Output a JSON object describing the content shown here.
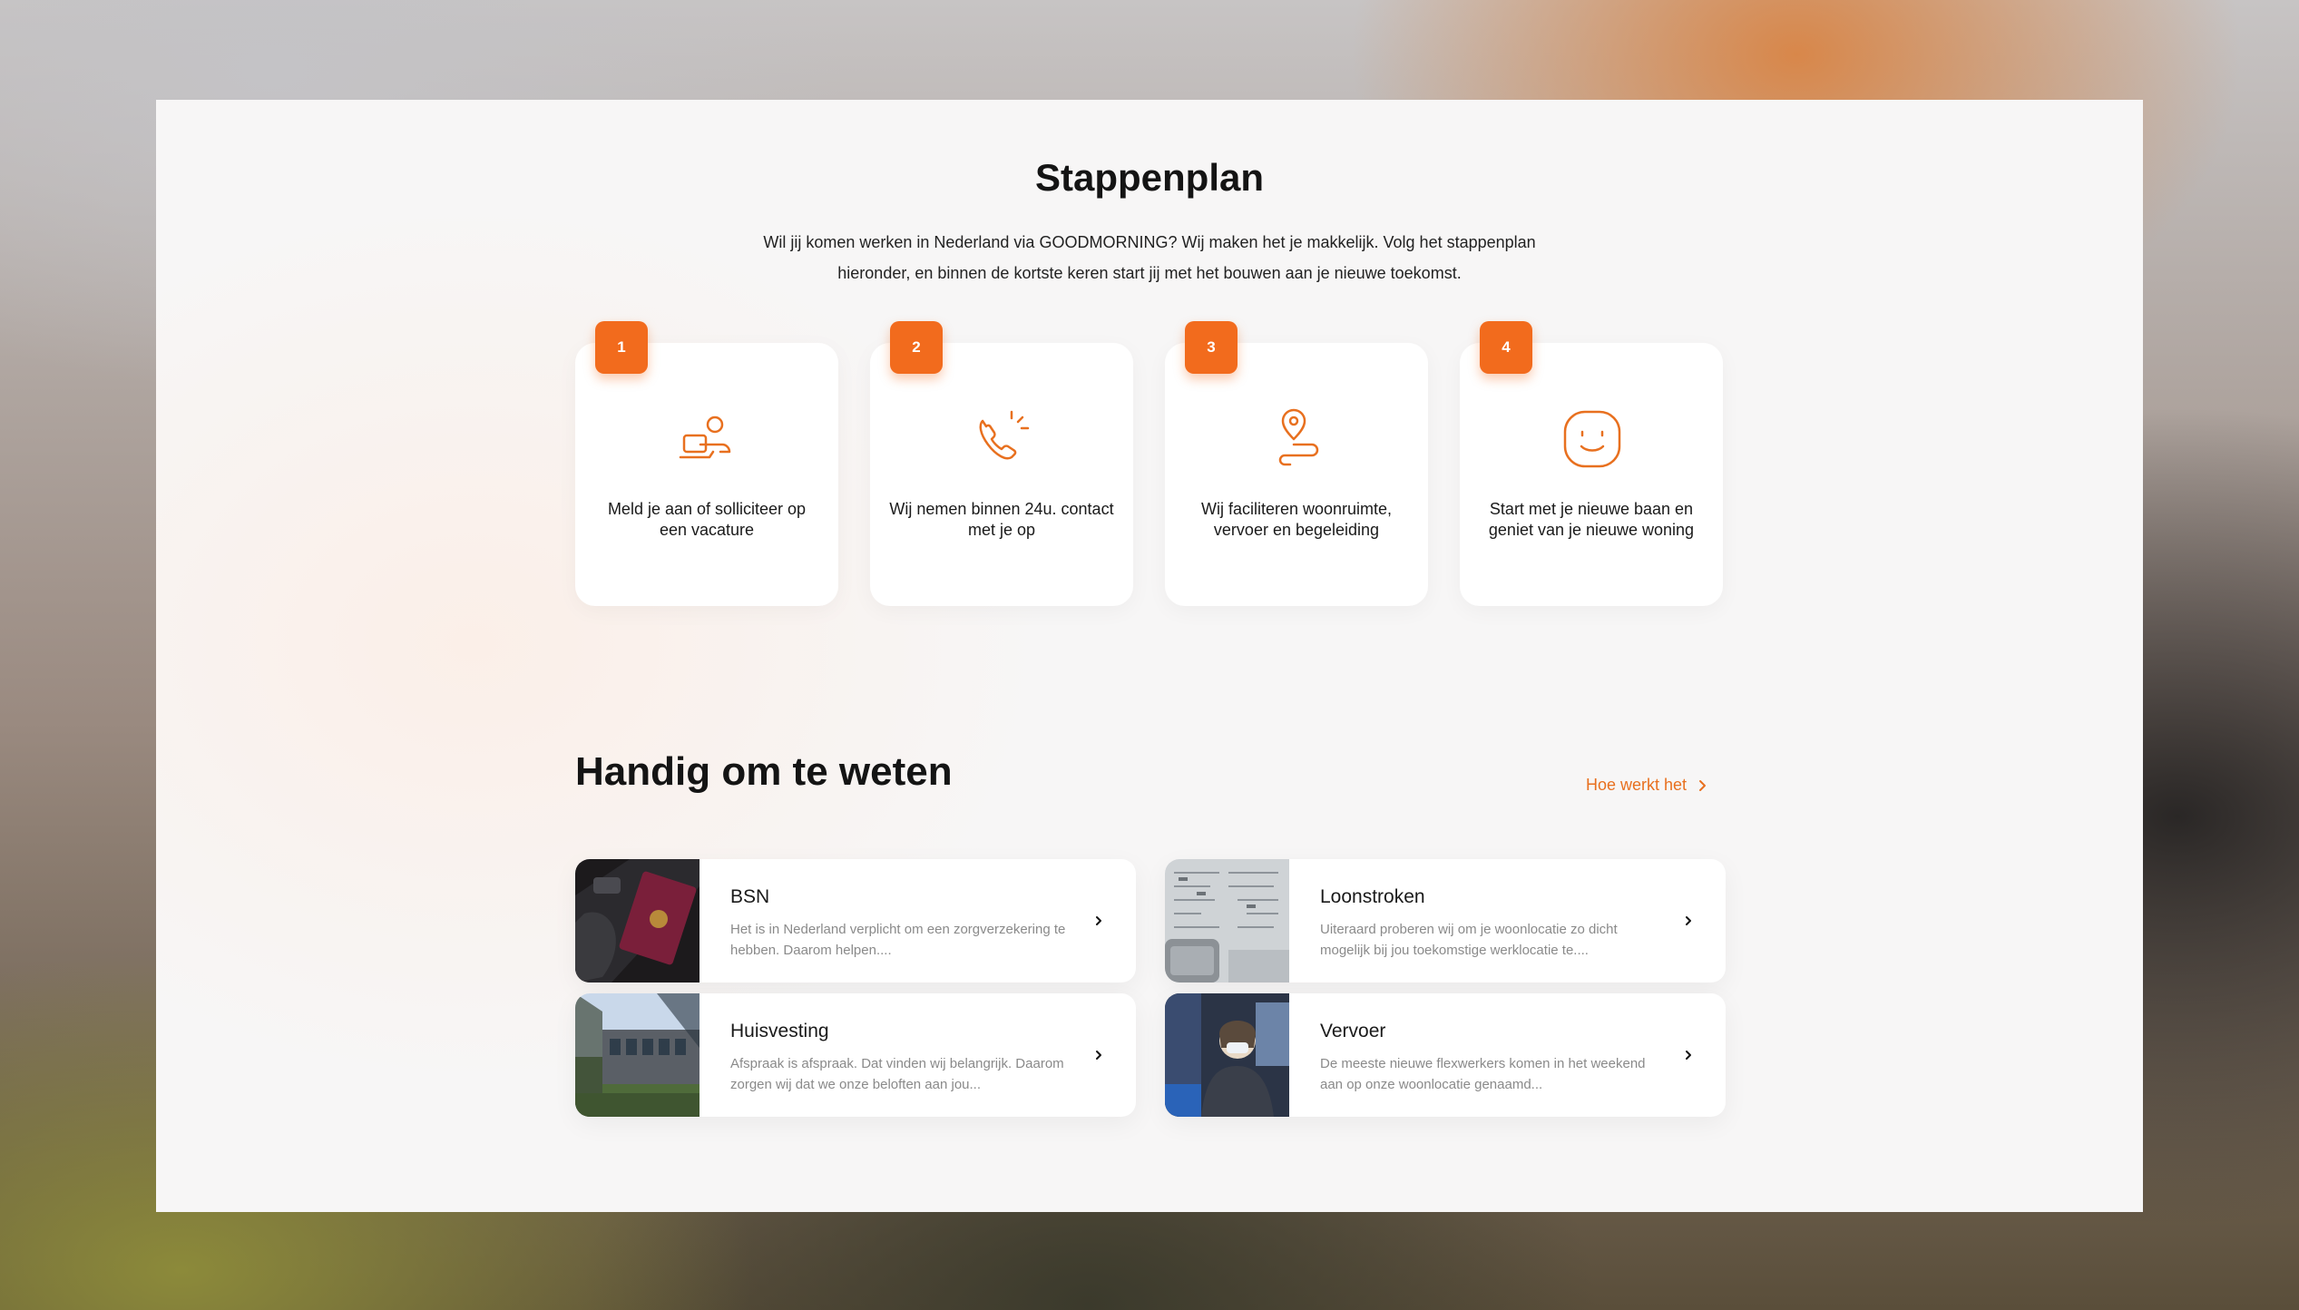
{
  "stappenplan": {
    "title": "Stappenplan",
    "intro": "Wil jij komen werken in Nederland via GOODMORNING? Wij maken het je makkelijk. Volg het stappenplan hieronder, en binnen de kortste keren start jij met het bouwen aan je nieuwe toekomst.",
    "steps": [
      {
        "number": "1",
        "icon": "person-laptop-icon",
        "label": "Meld je aan of solliciteer op een vacature"
      },
      {
        "number": "2",
        "icon": "phone-call-icon",
        "label": "Wij nemen binnen 24u. contact met je op"
      },
      {
        "number": "3",
        "icon": "location-route-icon",
        "label": "Wij faciliteren woonruimte, vervoer en begeleiding"
      },
      {
        "number": "4",
        "icon": "smiley-icon",
        "label": "Start met je nieuwe baan en geniet van je nieuwe woning"
      }
    ]
  },
  "handig": {
    "title": "Handig om te weten",
    "link_label": "Hoe werkt het",
    "cards": [
      {
        "title": "BSN",
        "text": "Het is in Nederland verplicht om een zorgverzekering te hebben. Daarom helpen....",
        "image": "passport-photo"
      },
      {
        "title": "Loonstroken",
        "text": "Uiteraard proberen wij om je woonlocatie zo dicht mogelijk bij jou toekomstige werklocatie te....",
        "image": "payslip-calculator-photo"
      },
      {
        "title": "Huisvesting",
        "text": "Afspraak is afspraak. Dat vinden wij belangrijk. Daarom zorgen wij dat we onze beloften aan jou...",
        "image": "housing-building-photo"
      },
      {
        "title": "Vervoer",
        "text": "De meeste nieuwe flexwerkers komen in het weekend aan op onze woonlocatie genaamd...",
        "image": "bus-passenger-photo"
      }
    ]
  },
  "colors": {
    "accent": "#f26b1d",
    "link": "#e8701f",
    "text": "#141414"
  }
}
